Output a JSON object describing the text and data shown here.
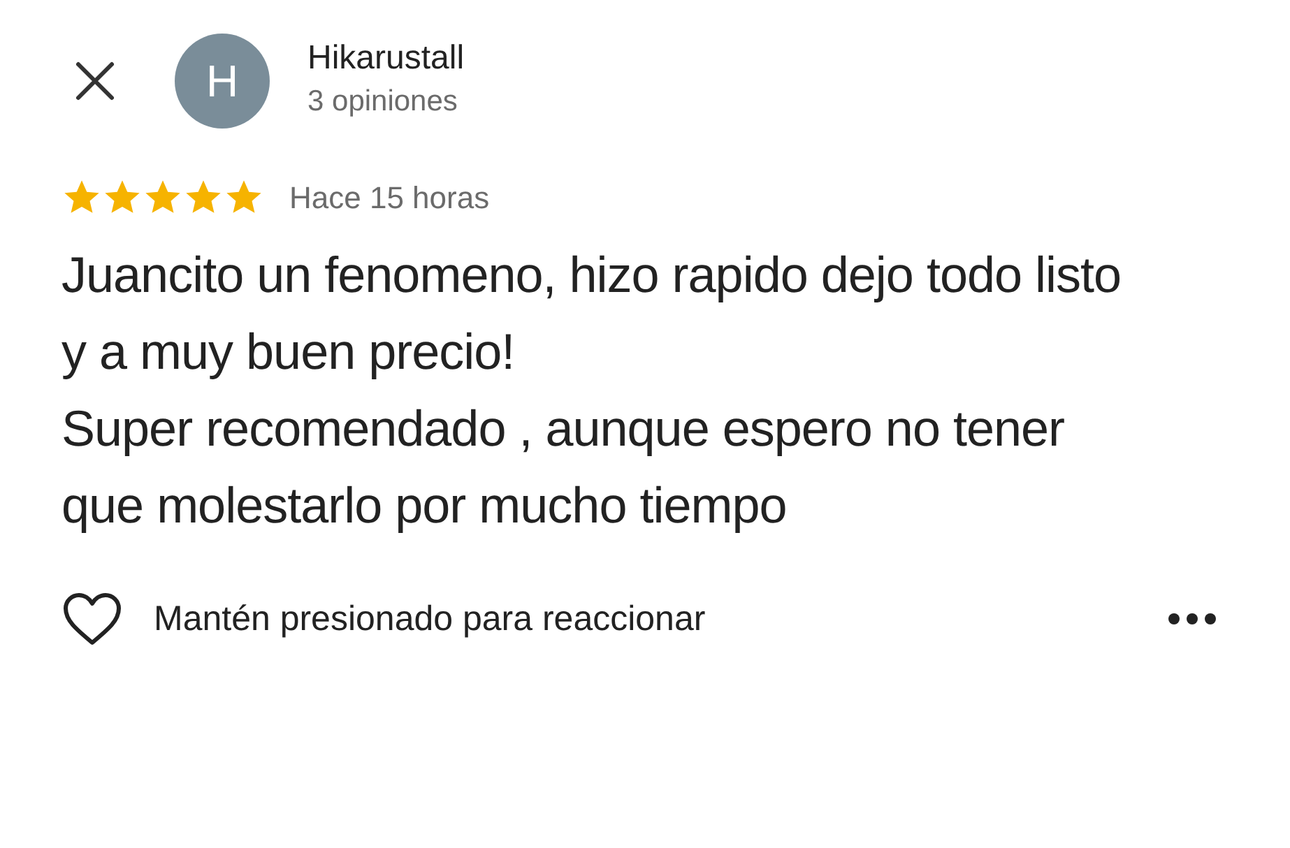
{
  "reviewer": {
    "initial": "H",
    "name": "Hikarustall",
    "review_count": "3 opiniones"
  },
  "review": {
    "stars": 5,
    "time": "Hace 15 horas",
    "paragraphs": [
      "Juancito un fenomeno, hizo rapido dejo todo listo y a muy buen precio!",
      "Super recomendado , aunque espero no tener que molestarlo por mucho tiempo"
    ]
  },
  "reaction": {
    "hint": "Mantén presionado para reaccionar"
  }
}
